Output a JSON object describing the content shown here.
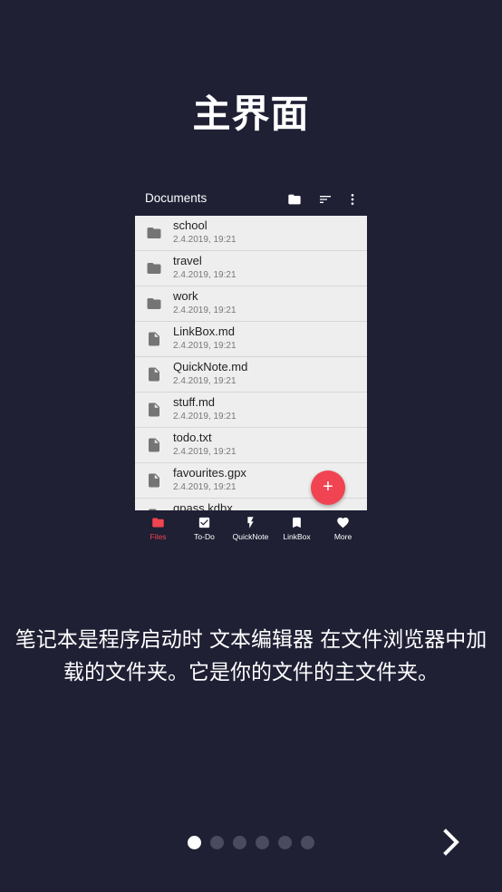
{
  "title": "主界面",
  "preview": {
    "appbar": {
      "title": "Documents",
      "icons": [
        "folder-icon",
        "sort-icon",
        "more-vert-icon"
      ]
    },
    "files": [
      {
        "name": "school",
        "date": "2.4.2019, 19:21",
        "type": "folder"
      },
      {
        "name": "travel",
        "date": "2.4.2019, 19:21",
        "type": "folder"
      },
      {
        "name": "work",
        "date": "2.4.2019, 19:21",
        "type": "folder"
      },
      {
        "name": "LinkBox.md",
        "date": "2.4.2019, 19:21",
        "type": "file"
      },
      {
        "name": "QuickNote.md",
        "date": "2.4.2019, 19:21",
        "type": "file"
      },
      {
        "name": "stuff.md",
        "date": "2.4.2019, 19:21",
        "type": "file"
      },
      {
        "name": "todo.txt",
        "date": "2.4.2019, 19:21",
        "type": "file"
      },
      {
        "name": "favourites.gpx",
        "date": "2.4.2019, 19:21",
        "type": "file"
      },
      {
        "name": "gpass.kdbx",
        "date": "",
        "type": "file"
      }
    ],
    "fab_label": "+",
    "nav": [
      {
        "label": "Files",
        "icon": "folder-icon",
        "active": true
      },
      {
        "label": "To-Do",
        "icon": "checkbox-icon",
        "active": false
      },
      {
        "label": "QuickNote",
        "icon": "bolt-icon",
        "active": false
      },
      {
        "label": "LinkBox",
        "icon": "bookmark-icon",
        "active": false
      },
      {
        "label": "More",
        "icon": "heart-icon",
        "active": false
      }
    ]
  },
  "description": "笔记本是程序启动时 文本编辑器 在文件浏览器中加载的文件夹。它是你的文件的主文件夹。",
  "pager": {
    "count": 6,
    "active_index": 0
  },
  "colors": {
    "background": "#1f2034",
    "accent": "#f04452",
    "list_background": "#eeeeee",
    "icon_gray": "#757575"
  }
}
